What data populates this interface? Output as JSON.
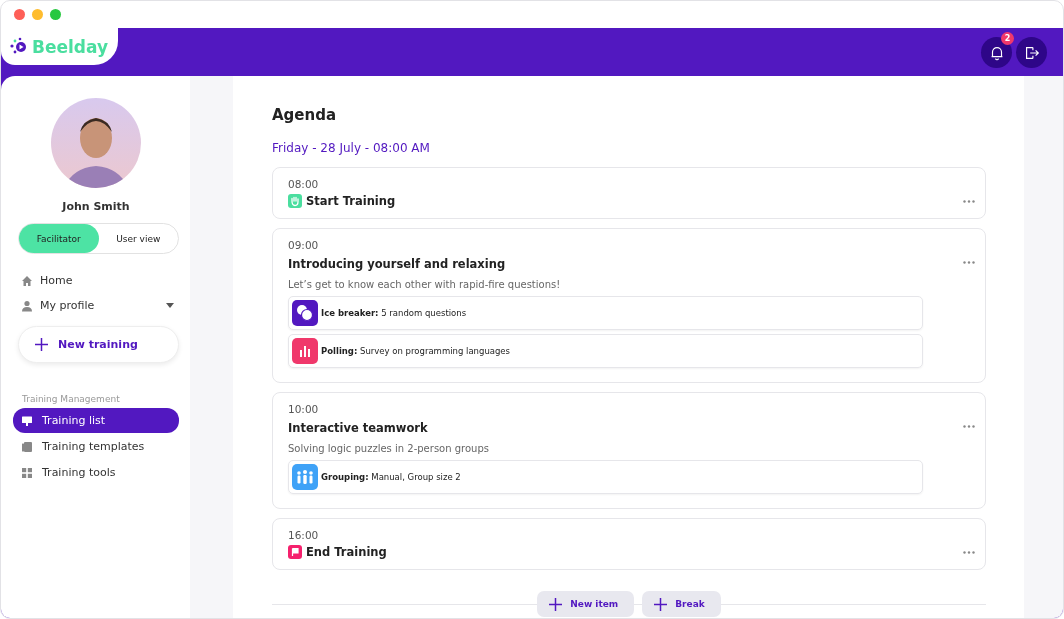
{
  "brand": {
    "name": "Beelday"
  },
  "header": {
    "notifications": "2"
  },
  "user": {
    "name": "John Smith"
  },
  "role_toggle": [
    {
      "label": "Facilitator",
      "selected": true
    },
    {
      "label": "User view",
      "selected": false
    }
  ],
  "nav": [
    {
      "label": "Home",
      "expandable": false
    },
    {
      "label": "My profile",
      "expandable": true
    }
  ],
  "new_training": {
    "label": "New training"
  },
  "management": {
    "heading": "Training Management",
    "items": [
      {
        "label": "Training list",
        "selected": true
      },
      {
        "label": "Training templates",
        "selected": false
      },
      {
        "label": "Training tools",
        "selected": false
      }
    ]
  },
  "agenda": {
    "title": "Agenda",
    "date": "Friday - 28 July - 08:00 AM",
    "items": [
      {
        "kind": "start",
        "time": "08:00",
        "title": "Start Training",
        "color": "#4ade9f"
      },
      {
        "kind": "session",
        "time": "09:00",
        "title": "Introducing yourself and relaxing",
        "description": "Let’s get to know each other with rapid-fire questions!",
        "activities": [
          {
            "kind": "icebreaker",
            "color": "#5218c0",
            "label": "Ice breaker:",
            "detail": "5 random questions"
          },
          {
            "kind": "polling",
            "color": "#f0386b",
            "label": "Polling:",
            "detail": "Survey on programming languages"
          }
        ]
      },
      {
        "kind": "session",
        "time": "10:00",
        "title": "Interactive teamwork",
        "description": "Solving logic puzzles in 2-person groups",
        "activities": [
          {
            "kind": "grouping",
            "color": "#3fa2f7",
            "label": "Grouping:",
            "detail": "Manual, Group size 2"
          }
        ]
      },
      {
        "kind": "end",
        "time": "16:00",
        "title": "End Training",
        "color": "#f5216d"
      }
    ],
    "buttons": [
      "New item",
      "Break"
    ]
  }
}
